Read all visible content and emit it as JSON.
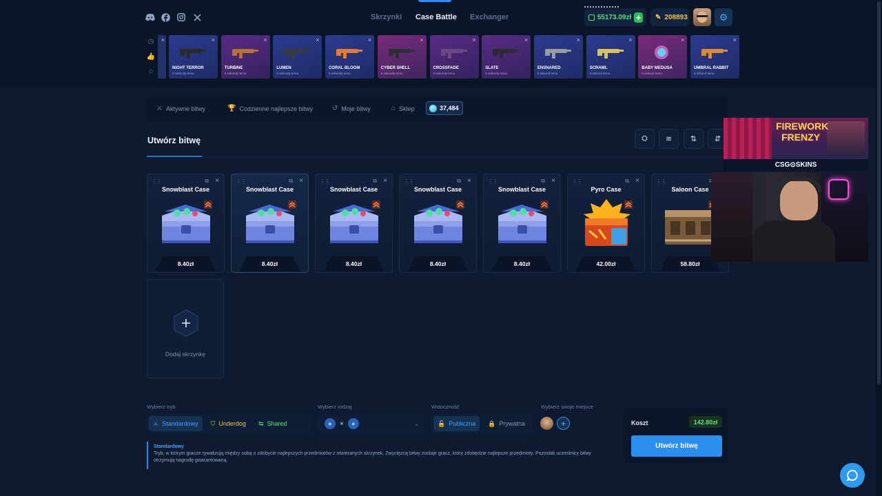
{
  "header": {
    "nav": [
      "Skrzynki",
      "Case Battle",
      "Exchanger"
    ],
    "active_nav": "Case Battle",
    "balance": "55173.09zł",
    "points": "208893",
    "social_icons": [
      "discord-icon",
      "facebook-icon",
      "instagram-icon",
      "x-icon"
    ]
  },
  "live_drops": [
    {
      "name": "NIGHT TERROR",
      "time": "5 sekundy temu"
    },
    {
      "name": "TURBINE",
      "time": "5 sekundy temu"
    },
    {
      "name": "LUMEN",
      "time": "5 sekundy temu"
    },
    {
      "name": "CORAL BLOOM",
      "time": "5 sekundy temu"
    },
    {
      "name": "CYBER SHELL",
      "time": "5 sekundy temu"
    },
    {
      "name": "CROSSFADE",
      "time": "5 sekundy temu"
    },
    {
      "name": "SLATE",
      "time": "5 sekundy temu"
    },
    {
      "name": "ENSNARED",
      "time": "5 sekund temu"
    },
    {
      "name": "SCRAWL",
      "time": "5 sekund temu"
    },
    {
      "name": "BABY MEDUSA",
      "time": "5 sekund temu"
    },
    {
      "name": "UMBRAL RABBIT",
      "time": "5 sekund temu"
    }
  ],
  "tabs": {
    "active_battles": "Aktywne bitwy",
    "daily_best": "Codzienne najlepsze bitwy",
    "my_battles": "Moje bitwy",
    "shop": "Sklep",
    "coins": "37,484"
  },
  "create": {
    "title": "Utwórz bitwę",
    "add_case": "Dodaj skrzynkę"
  },
  "cases": [
    {
      "name": "Snowblast Case",
      "price": "8.40zł"
    },
    {
      "name": "Snowblast Case",
      "price": "8.40zł"
    },
    {
      "name": "Snowblast Case",
      "price": "8.40zł"
    },
    {
      "name": "Snowblast Case",
      "price": "8.40zł"
    },
    {
      "name": "Snowblast Case",
      "price": "8.40zł"
    },
    {
      "name": "Pyro Case",
      "price": "42.00zł"
    },
    {
      "name": "Saloon Case",
      "price": "58.80zł"
    }
  ],
  "settings": {
    "mode_label": "Wybierz tryb",
    "modes": [
      "Standardowy",
      "Underdog",
      "Shared"
    ],
    "selected_mode": "Standardowy",
    "type_label": "Wybierz rodzaj",
    "type_vs": "×",
    "visibility_label": "Widoczność",
    "visibility": [
      "Publiczna",
      "Prywatna"
    ],
    "selected_visibility": "Publiczna",
    "seat_label": "Wybierz swoje miejsce"
  },
  "description": {
    "title": "Standardowy",
    "text": "Tryb, w którym gracze rywalizują między sobą o zdobycie najlepszych przedmiotów z otwieranych skrzynek. Zwycięzcą bitwy zostaje gracz, który zdobędzie najlepsze przedmioty. Pozostali uczestnicy bitwy otrzymują nagrodę gwarantowaną."
  },
  "cost": {
    "label": "Koszt",
    "value": "142.80zł",
    "button": "Utwórz bitwę"
  },
  "overlay": {
    "banner_title_1": "FIREWORK",
    "banner_title_2": "FRENZY",
    "brand": "CSG⊙SKINS"
  },
  "colors": {
    "accent": "#2d8cff",
    "green": "#58e07a",
    "gold": "#f2c14e",
    "background": "#0d1a30"
  }
}
